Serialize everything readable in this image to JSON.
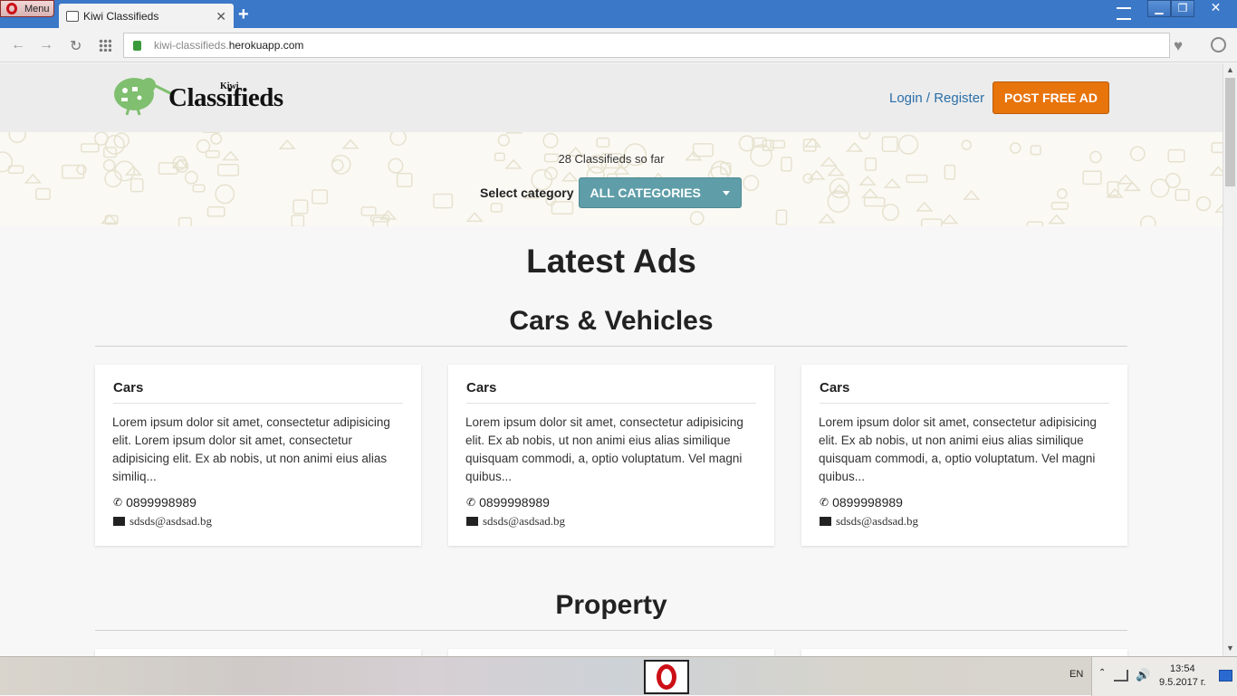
{
  "browser": {
    "menu_label": "Menu",
    "tab_title": "Kiwi Classifieds",
    "tab_close": "✕",
    "new_tab": "+",
    "url_plain": "kiwi-classifieds.",
    "url_domain": "herokuapp.com",
    "win_min": "▁",
    "win_max": "❐",
    "win_close": "✕",
    "back": "←",
    "forward": "→",
    "reload": "↻",
    "bookmark": "♥"
  },
  "header": {
    "logo_kiwi": "Kiwi",
    "logo_brand": "Classifieds",
    "login": "Login / Register",
    "post_ad": "POST FREE AD"
  },
  "hero": {
    "count": "28 Classifieds so far",
    "select_label": "Select category",
    "select_value": "ALL CATEGORIES"
  },
  "main": {
    "heading": "Latest Ads",
    "sections": [
      {
        "title": "Cars & Vehicles",
        "cards": [
          {
            "title": "Cars",
            "desc": "Lorem ipsum dolor sit amet, consectetur adipisicing elit. Lorem ipsum dolor sit amet, consectetur adipisicing elit. Ex ab nobis, ut non animi eius alias similiq...",
            "phone": "0899998989",
            "email": "sdsds@asdsad.bg"
          },
          {
            "title": "Cars",
            "desc": "Lorem ipsum dolor sit amet, consectetur adipisicing elit. Ex ab nobis, ut non animi eius alias similique quisquam commodi, a, optio voluptatum. Vel magni quibus...",
            "phone": "0899998989",
            "email": "sdsds@asdsad.bg"
          },
          {
            "title": "Cars",
            "desc": "Lorem ipsum dolor sit amet, consectetur adipisicing elit. Ex ab nobis, ut non animi eius alias similique quisquam commodi, a, optio voluptatum. Vel magni quibus...",
            "phone": "0899998989",
            "email": "sdsds@asdsad.bg"
          }
        ]
      },
      {
        "title": "Property"
      }
    ]
  },
  "taskbar": {
    "lang": "EN",
    "time": "13:54",
    "date": "9.5.2017 г."
  },
  "colors": {
    "accent_orange": "#e8740c",
    "category_teal": "#5f9ea8",
    "link_blue": "#2a6fa8",
    "titlebar_blue": "#3c78c8"
  },
  "icons": [
    "opera-icon",
    "lock-icon",
    "heart-icon",
    "account-icon",
    "phone-icon",
    "envelope-icon",
    "caret-down-icon",
    "kiwi-bird-icon"
  ]
}
